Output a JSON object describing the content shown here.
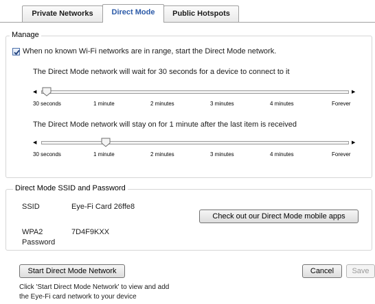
{
  "tabs": [
    {
      "label": "Private Networks"
    },
    {
      "label": "Direct Mode"
    },
    {
      "label": "Public Hotspots"
    }
  ],
  "manage": {
    "title": "Manage",
    "checkbox_label": "When no known Wi-Fi networks are in range, start the Direct Mode network.",
    "checkbox_checked": true,
    "wait_text": "The Direct Mode network will wait for 30 seconds for a device to connect to it",
    "wait_value_index": 0,
    "stay_text": "The Direct Mode network will stay on for 1 minute after the last item is received",
    "stay_value_index": 1,
    "ticks": [
      "30 seconds",
      "1 minute",
      "2 minutes",
      "3 minutes",
      "4 minutes",
      "Forever"
    ]
  },
  "ssid_section": {
    "title": "Direct Mode SSID and Password",
    "ssid_label": "SSID",
    "ssid_value": "Eye-Fi Card 26ffe8",
    "wpa_label_1": "WPA2",
    "wpa_label_2": "Password",
    "wpa_value": "7D4F9KXX",
    "apps_button": "Check out our Direct Mode mobile apps"
  },
  "footer": {
    "start_button": "Start Direct Mode Network",
    "cancel_button": "Cancel",
    "save_button": "Save",
    "hint_line1": "Click 'Start Direct Mode Network' to view and add",
    "hint_line2": "the Eye-Fi card network to your device"
  },
  "colors": {
    "active_tab_text": "#2b5aa8",
    "checkbox_check": "#1f3f7a"
  }
}
